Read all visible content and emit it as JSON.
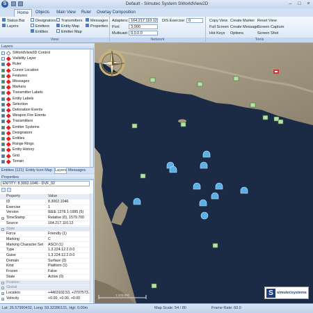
{
  "window": {
    "title": "Default - Simutec System SWorldView2D",
    "app_logo": "S"
  },
  "ribbon_tabs": [
    "Home",
    "Objects",
    "Main View",
    "Ruler",
    "Overlay Composition"
  ],
  "ribbon": {
    "view": {
      "label": "View",
      "col1": [
        "Status Bar",
        "Layers"
      ],
      "col2": [
        "Designators",
        "Emitters",
        "Entities"
      ],
      "col3": [
        "Transmitters",
        "Entity Map",
        "Emitter Map"
      ],
      "col4": [
        "Messages",
        "Properties"
      ]
    },
    "network": {
      "label": "Network",
      "adapters_label": "Adapters:",
      "adapters_value": "164.217.110.12",
      "port_label": "Port:",
      "port_value": "3,000",
      "multicast_label": "Multicast:",
      "multicast_value": "0.0.0.0",
      "dis_label": "DIS Exercise:",
      "dis_value": "0"
    },
    "tools": {
      "label": "Tools",
      "col1": [
        "Copy View",
        "Full Screen",
        "Hot Keys"
      ],
      "col2": [
        "Create Marker",
        "Create Message",
        "Options"
      ],
      "col3": [
        "Reset View",
        "Screen Capture",
        "Screen Shot"
      ]
    }
  },
  "layers": {
    "title": "Layers",
    "items": [
      {
        "label": "SWorldView3D Control",
        "checked": false
      },
      {
        "label": "Visibility Layer",
        "checked": false
      },
      {
        "label": "Ruler",
        "checked": true
      },
      {
        "label": "Cursor Location",
        "checked": true
      },
      {
        "label": "Features",
        "checked": true
      },
      {
        "label": "Messages",
        "checked": true
      },
      {
        "label": "Markers",
        "checked": true
      },
      {
        "label": "Transmitter Labels",
        "checked": true
      },
      {
        "label": "Entity Labels",
        "checked": true
      },
      {
        "label": "Selection",
        "checked": true
      },
      {
        "label": "Detonation Events",
        "checked": true
      },
      {
        "label": "Weapon Fire Events",
        "checked": true
      },
      {
        "label": "Transmitters",
        "checked": true
      },
      {
        "label": "Emitter Systems",
        "checked": true
      },
      {
        "label": "Designators",
        "checked": true
      },
      {
        "label": "Entities",
        "checked": true
      },
      {
        "label": "Range Rings",
        "checked": true
      },
      {
        "label": "Entity History",
        "checked": true
      },
      {
        "label": "Grid",
        "checked": true
      },
      {
        "label": "Terrain",
        "checked": true
      }
    ]
  },
  "panel_tabs": [
    "Entities (121)",
    "Entity Icon Map",
    "Layers",
    "Messages"
  ],
  "properties": {
    "title": "Properties",
    "entity_select": "ENTITY: 8.3002.1046 - DVF_02",
    "col_property": "Property",
    "col_value": "Value",
    "rows": [
      {
        "name": "ID",
        "value": "8.3002.1046",
        "kind": "row"
      },
      {
        "name": "Exercise",
        "value": "1",
        "kind": "row"
      },
      {
        "name": "Version",
        "value": "IEEE 1278.1-1995 (5)",
        "kind": "row"
      },
      {
        "name": "TimeStamp",
        "value": "Relative (0), 1579.700",
        "kind": "expand"
      },
      {
        "name": "Source",
        "value": "164.217.110.12",
        "kind": "row"
      },
      {
        "name": "State",
        "value": "",
        "kind": "cat"
      },
      {
        "name": "Force",
        "value": "Friendly (1)",
        "kind": "row"
      },
      {
        "name": "Marking",
        "value": "C",
        "kind": "row"
      },
      {
        "name": "Marking Character Set",
        "value": "ASCII (1)",
        "kind": "row"
      },
      {
        "name": "Type",
        "value": "1.3.224.12.2.0.0",
        "kind": "row"
      },
      {
        "name": "Guise",
        "value": "1.3.224.12.2.0.0",
        "kind": "row"
      },
      {
        "name": "Domain",
        "value": "Surface (3)",
        "kind": "row"
      },
      {
        "name": "Kind",
        "value": "Platform (1)",
        "kind": "row"
      },
      {
        "name": "Frozen",
        "value": "False",
        "kind": "row"
      },
      {
        "name": "State",
        "value": "Active (0)",
        "kind": "row"
      },
      {
        "name": "Position",
        "value": "",
        "kind": "cat"
      },
      {
        "name": "Global",
        "value": "",
        "kind": "cat"
      },
      {
        "name": "Location",
        "value": "+4463102.53, +2707573...",
        "kind": "expand"
      },
      {
        "name": "Velocity",
        "value": "+0.00, +0.00, +0.00",
        "kind": "expand"
      }
    ]
  },
  "status": {
    "coords": "Lat: 26.57990432, Long: 59.32286131, Hgt: 0.00m",
    "map_scale": "Map Scale: 54 / 80",
    "frame_rate": "Frame Rate: 60.0"
  },
  "map": {
    "logo_letter": "S",
    "logo_text": "simutecsystems",
    "scale_label": "1:100,000"
  },
  "colors": {
    "water": "#1b2b45",
    "land": "#a09580",
    "friendly": "#5ab0e6",
    "marker": "#b9e0a8",
    "selected_red": "#e0303a"
  }
}
